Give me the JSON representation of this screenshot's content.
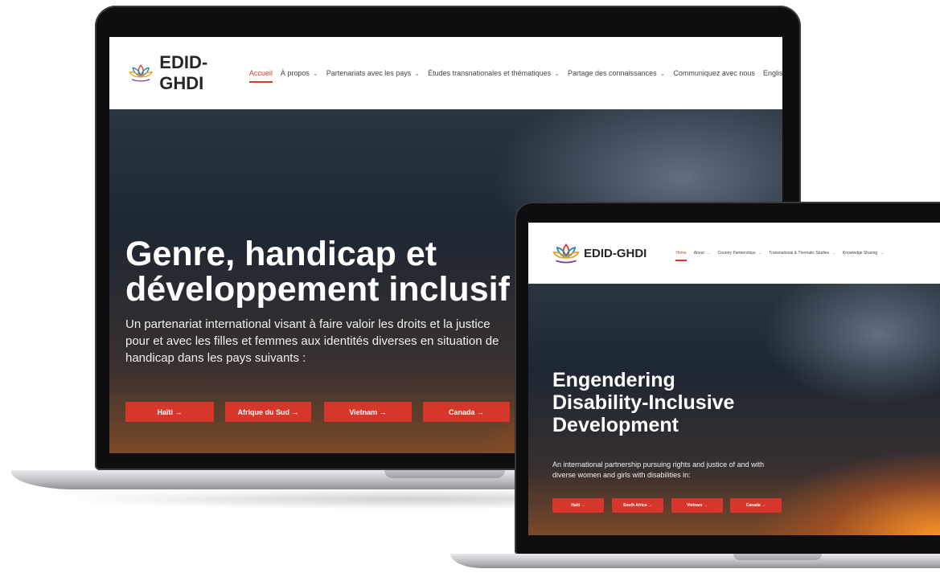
{
  "brand": {
    "name": "EDID-GHDI"
  },
  "french": {
    "nav": [
      {
        "label": "Accueil",
        "active": true,
        "dropdown": false
      },
      {
        "label": "À propos",
        "active": false,
        "dropdown": true
      },
      {
        "label": "Partenariats avec les pays",
        "active": false,
        "dropdown": true
      },
      {
        "label": "Études transnationales et thématiques",
        "active": false,
        "dropdown": true
      },
      {
        "label": "Partage des connaissances",
        "active": false,
        "dropdown": true
      },
      {
        "label": "Communiquez avec nous",
        "active": false,
        "dropdown": false
      },
      {
        "label": "English",
        "active": false,
        "dropdown": false
      }
    ],
    "hero": {
      "title_line1": "Genre, handicap et",
      "title_line2": "développement inclusif",
      "subtitle": "Un partenariat international visant à faire valoir les droits et la justice pour et avec les filles et femmes aux identités diverses en situation de handicap dans les pays suivants :",
      "buttons": [
        "Haïti",
        "Afrique du Sud",
        "Vietnam",
        "Canada"
      ]
    }
  },
  "english": {
    "nav": [
      {
        "label": "Home",
        "active": true,
        "dropdown": false
      },
      {
        "label": "About",
        "active": false,
        "dropdown": true
      },
      {
        "label": "Country Partnerships",
        "active": false,
        "dropdown": true
      },
      {
        "label": "Transnational & Thematic Studies",
        "active": false,
        "dropdown": true
      },
      {
        "label": "Knowledge Sharing",
        "active": false,
        "dropdown": true
      }
    ],
    "hero": {
      "title_line1": "Engendering",
      "title_line2": "Disability-Inclusive",
      "title_line3": "Development",
      "subtitle": "An international partnership pursuing rights and justice of and with diverse women and girls with disabilities in:",
      "buttons": [
        "Haiti",
        "South Africa",
        "Vietnam",
        "Canada"
      ]
    }
  },
  "icons": {
    "arrow": "→",
    "chevron": "⌄"
  },
  "colors": {
    "accent": "#d7372b",
    "nav_active": "#d33a2c"
  }
}
